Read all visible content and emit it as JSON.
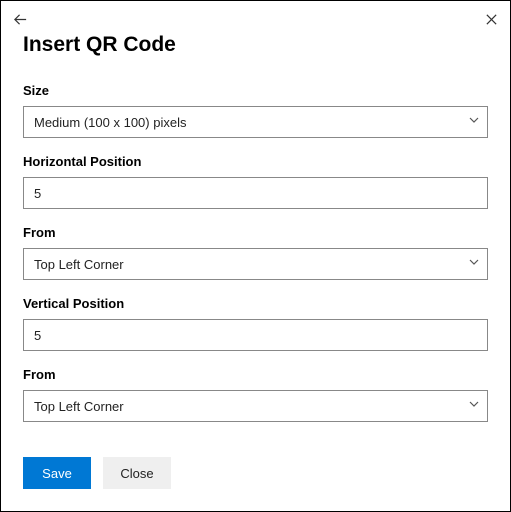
{
  "dialog": {
    "title": "Insert QR Code"
  },
  "fields": {
    "size": {
      "label": "Size",
      "value": "Medium (100 x 100) pixels"
    },
    "horizontal_position": {
      "label": "Horizontal Position",
      "value": "5"
    },
    "horizontal_from": {
      "label": "From",
      "value": "Top Left Corner"
    },
    "vertical_position": {
      "label": "Vertical Position",
      "value": "5"
    },
    "vertical_from": {
      "label": "From",
      "value": "Top Left Corner"
    }
  },
  "buttons": {
    "save": "Save",
    "close": "Close"
  }
}
